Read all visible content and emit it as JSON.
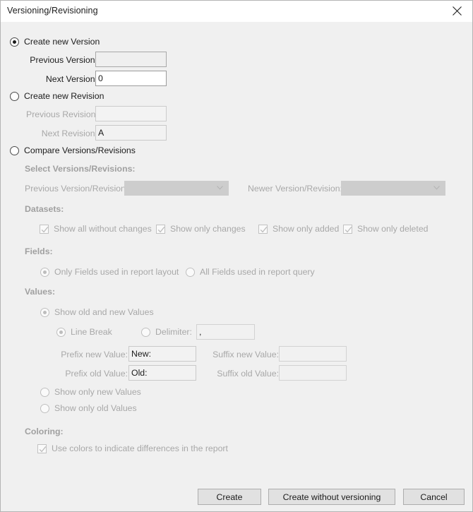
{
  "window": {
    "title": "Versioning/Revisioning",
    "close_icon": "close-icon"
  },
  "mode_options": {
    "create_version": "Create new Version",
    "create_revision": "Create new Revision",
    "compare": "Compare Versions/Revisions",
    "selected": "create_version"
  },
  "version_group": {
    "previous_label": "Previous Version:",
    "previous_value": "",
    "next_label": "Next Version:",
    "next_value": "0"
  },
  "revision_group": {
    "previous_label": "Previous Revision:",
    "previous_value": "",
    "next_label": "Next Revision:",
    "next_value": "A"
  },
  "compare_group": {
    "select_header": "Select Versions/Revisions:",
    "previous_label": "Previous Version/Revision:",
    "previous_value": "",
    "newer_label": "Newer Version/Revision:",
    "newer_value": "",
    "datasets_header": "Datasets:",
    "datasets": [
      {
        "label": "Show all without changes",
        "checked": true
      },
      {
        "label": "Show only changes",
        "checked": true
      },
      {
        "label": "Show only added",
        "checked": true
      },
      {
        "label": "Show only deleted",
        "checked": true
      }
    ],
    "fields_header": "Fields:",
    "fields_options": [
      {
        "label": "Only Fields used in report layout",
        "checked": true
      },
      {
        "label": "All Fields used in report query",
        "checked": false
      }
    ],
    "values_header": "Values:",
    "values_options": [
      {
        "label": "Show old and new Values",
        "checked": true
      },
      {
        "label": "Show only new Values",
        "checked": false
      },
      {
        "label": "Show only old Values",
        "checked": false
      }
    ],
    "separator_options": [
      {
        "label": "Line Break",
        "checked": true
      },
      {
        "label": "Delimiter:",
        "checked": false
      }
    ],
    "delimiter_value": ",",
    "prefix_new_label": "Prefix new Value:",
    "prefix_new_value": "New:",
    "suffix_new_label": "Suffix new Value:",
    "suffix_new_value": "",
    "prefix_old_label": "Prefix old Value:",
    "prefix_old_value": "Old:",
    "suffix_old_label": "Suffix old Value:",
    "suffix_old_value": "",
    "coloring_header": "Coloring:",
    "coloring_checkbox": {
      "label": "Use colors to indicate differences in the report",
      "checked": true
    }
  },
  "footer": {
    "create": "Create",
    "create_without_versioning": "Create without versioning",
    "cancel": "Cancel"
  },
  "colors": {
    "dialog_bg": "#f0f0f0",
    "titlebar_bg": "#ffffff",
    "text": "#1b1b1b",
    "disabled_text": "#a8a8a8",
    "section_header": "#a0a0a0",
    "combo_fill": "#cdcdcd",
    "button_bg": "#e1e1e1"
  }
}
